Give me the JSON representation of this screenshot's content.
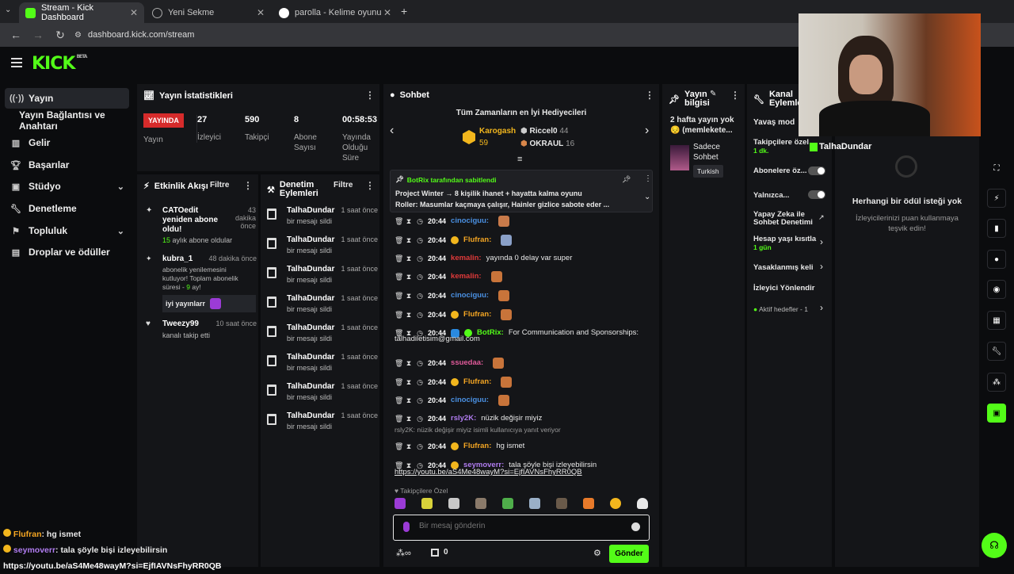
{
  "browser": {
    "tabs": [
      {
        "title": "Stream - Kick Dashboard",
        "active": true
      },
      {
        "title": "Yeni Sekme",
        "active": false
      },
      {
        "title": "parolla - Kelime oyunu. Günlük",
        "active": false
      }
    ],
    "url": "dashboard.kick.com/stream"
  },
  "brand": {
    "logo": "KICK",
    "beta": "BETA"
  },
  "nav": {
    "items": [
      {
        "label": "Yayın",
        "icon": "broadcast-icon"
      },
      {
        "label": "Yayın Bağlantısı ve Anahtarı",
        "icon": ""
      },
      {
        "label": "Gelir",
        "icon": "revenue-icon"
      },
      {
        "label": "Başarılar",
        "icon": "trophy-icon"
      },
      {
        "label": "Stüdyo",
        "icon": "studio-icon"
      },
      {
        "label": "Denetleme",
        "icon": "wrench-icon"
      },
      {
        "label": "Topluluk",
        "icon": "community-icon"
      },
      {
        "label": "Droplar ve ödüller",
        "icon": "gift-icon"
      }
    ]
  },
  "stats": {
    "title": "Yayın İstatistikleri",
    "live": "YAYINDA",
    "live_label": "Yayın",
    "viewers": "27",
    "viewers_label": "İzleyici",
    "followers": "590",
    "followers_label": "Takipçi",
    "subs": "8",
    "subs_label": "Abone Sayısı",
    "uptime": "00:58:53",
    "uptime_label": "Yayında Olduğu Süre"
  },
  "activity": {
    "title": "Etkinlik Akışı",
    "filter": "Filtre",
    "events": [
      {
        "name": "CATOedit yeniden abone oldu!",
        "time": "43 dakika önce",
        "detail_num": "15",
        "detail": "aylık abone oldular"
      },
      {
        "name": "kubra_1",
        "time": "48 dakika önce",
        "detail": "abonelik yenilemesini kutluyor! Toplam abonelik süresi -",
        "detail_num": "9",
        "detail_tail": "ay!",
        "msg": "iyi yayınlarr"
      },
      {
        "name": "Tweezy99",
        "time": "10 saat önce",
        "detail": "kanalı takip etti"
      }
    ]
  },
  "moderation": {
    "title": "Denetim Eylemleri",
    "filter": "Filtre",
    "rows": [
      {
        "name": "TalhaDundar",
        "sub": "bir mesajı sildi",
        "time": "1 saat önce"
      },
      {
        "name": "TalhaDundar",
        "sub": "bir mesajı sildi",
        "time": "1 saat önce"
      },
      {
        "name": "TalhaDundar",
        "sub": "bir mesajı sildi",
        "time": "1 saat önce"
      },
      {
        "name": "TalhaDundar",
        "sub": "bir mesajı sildi",
        "time": "1 saat önce"
      },
      {
        "name": "TalhaDundar",
        "sub": "bir mesajı sildi",
        "time": "1 saat önce"
      },
      {
        "name": "TalhaDundar",
        "sub": "bir mesajı sildi",
        "time": "1 saat önce"
      },
      {
        "name": "TalhaDundar",
        "sub": "bir mesajı sildi",
        "time": "1 saat önce"
      },
      {
        "name": "TalhaDundar",
        "sub": "bir mesajı sildi",
        "time": "1 saat önce"
      }
    ]
  },
  "chat": {
    "title": "Sohbet",
    "leaders_title": "Tüm Zamanların en İyi Hediyecileri",
    "leaders": [
      {
        "rank": "1",
        "name": "Karogash",
        "value": "59"
      },
      {
        "rank": "2",
        "name": "Riccel0",
        "value": "44"
      },
      {
        "rank": "3",
        "name": "OKRAUL",
        "value": "16"
      }
    ],
    "pinned_by": "BotRix tarafından sabitlendi",
    "pinned_line1": "Project Winter → 8 kişilik ihanet + hayatta kalma oyunu",
    "pinned_line2": "Roller: Masumlar kaçmaya çalışır, Hainler gizlice sabote eder ...",
    "messages": [
      {
        "time": "20:44",
        "user": "cinociguu:",
        "color": "#4a90e2",
        "text": ""
      },
      {
        "time": "20:44",
        "user": "Flufran:",
        "color": "#f5a623",
        "text": ""
      },
      {
        "time": "20:44",
        "user": "kemalin:",
        "color": "#e03a3a",
        "text": "yayında 0 delay var super"
      },
      {
        "time": "20:44",
        "user": "kemalin:",
        "color": "#e03a3a",
        "text": ""
      },
      {
        "time": "20:44",
        "user": "cinociguu:",
        "color": "#4a90e2",
        "text": ""
      },
      {
        "time": "20:44",
        "user": "Flufran:",
        "color": "#f5a623",
        "text": ""
      },
      {
        "time": "20:44",
        "user": "BotRix:",
        "color": "#53fc18",
        "text": "For Communication and Sponsorships:"
      },
      {
        "time": "20:44",
        "user": "ssuedaa:",
        "color": "#e05a9a",
        "text": ""
      },
      {
        "time": "20:44",
        "user": "Flufran:",
        "color": "#f5a623",
        "text": ""
      },
      {
        "time": "20:44",
        "user": "cinociguu:",
        "color": "#4a90e2",
        "text": ""
      },
      {
        "time": "20:44",
        "user": "rsly2K:",
        "color": "#b07cf0",
        "text": "nüzik değişir miyiz"
      },
      {
        "time": "20:44",
        "user": "Flufran:",
        "color": "#f5a623",
        "text": "hg ismet"
      },
      {
        "time": "20:44",
        "user": "seymoverr:",
        "color": "#b07cf0",
        "text": "tala şöyle bişi izleyebilirsin"
      }
    ],
    "botrix_email": "talhadiletisim@gmail.com",
    "reply_note": "rsly2K: nüzik değişir miyiz isimli kullanıcıya yanıt veriyor",
    "link": "https://youtu.be/aS4Me48wayM?si=EjfIAVNsFhyRR0QB",
    "followers_only": "Takipçilere Özel",
    "input_placeholder": "Bir mesaj gönderin",
    "points": "0",
    "send": "Gönder"
  },
  "stream_info": {
    "title": "Yayın bilgisi",
    "text": "2 hafta yayın yok 😔 (memlekete...",
    "category": "Sadece Sohbet",
    "tag": "Turkish"
  },
  "channel_actions": {
    "title": "Kanal Eylemleri",
    "items": [
      {
        "label": "Yavaş mod",
        "sub": ""
      },
      {
        "label": "Takipçilere özel",
        "sub": "1 dk."
      },
      {
        "label": "Abonelere öz...",
        "sub": ""
      },
      {
        "label": "Yalnızca...",
        "sub": ""
      },
      {
        "label": "Yapay Zeka ile Sohbet Denetimi",
        "sub": ""
      },
      {
        "label": "Hesap yaşı kısıtla",
        "sub": "1 gün"
      },
      {
        "label": "Yasaklanmış keli",
        "sub": ""
      },
      {
        "label": "İzleyici Yönlendir",
        "sub": ""
      },
      {
        "label": "Aktif hedefler - 1",
        "sub": ""
      }
    ]
  },
  "rewards": {
    "title": "Herhangi bir ödül isteği yok",
    "text": "İzleyicilerinizi puan kullanmaya teşvik edin!"
  },
  "webcam": {
    "name": "TalhaDundar"
  },
  "overlay": {
    "lines": [
      {
        "user": "Flufran",
        "text": ": hg ismet"
      },
      {
        "user": "seymoverr",
        "text": ": tala şöyle bişi izleyebilirsin"
      }
    ],
    "link": "https://youtu.be/aS4Me48wayM?si=EjfIAVNsFhyRR0QB"
  },
  "colors": {
    "accent": "#53fc18",
    "live": "#d62b2b",
    "panel": "#141518"
  }
}
